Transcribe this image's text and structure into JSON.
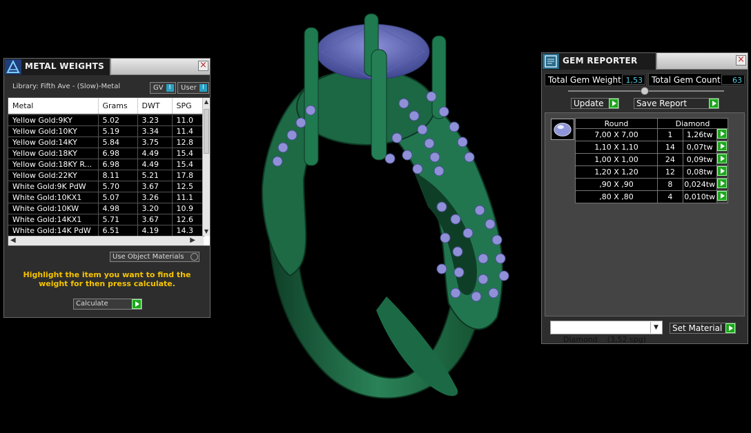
{
  "metal_weights": {
    "title": "METAL WEIGHTS",
    "library": "Library: Fifth Ave - (Slow)-Metal",
    "gv_label": "GV",
    "user_label": "User",
    "columns": [
      "Metal",
      "Grams",
      "DWT",
      "SPG"
    ],
    "rows": [
      [
        "Yellow Gold:9KY",
        "5.02",
        "3.23",
        "11.0"
      ],
      [
        "Yellow Gold:10KY",
        "5.19",
        "3.34",
        "11.4"
      ],
      [
        "Yellow Gold:14KY",
        "5.84",
        "3.75",
        "12.8"
      ],
      [
        "Yellow Gold:18KY",
        "6.98",
        "4.49",
        "15.4"
      ],
      [
        "Yellow Gold:18KY R...",
        "6.98",
        "4.49",
        "15.4"
      ],
      [
        "Yellow Gold:22KY",
        "8.11",
        "5.21",
        "17.8"
      ],
      [
        "White Gold:9K PdW",
        "5.70",
        "3.67",
        "12.5"
      ],
      [
        "White Gold:10KX1",
        "5.07",
        "3.26",
        "11.1"
      ],
      [
        "White Gold:10KW",
        "4.98",
        "3.20",
        "10.9"
      ],
      [
        "White Gold:14KX1",
        "5.71",
        "3.67",
        "12.6"
      ],
      [
        "White Gold:14K PdW",
        "6.51",
        "4.19",
        "14.3"
      ]
    ],
    "use_object_materials": "Use Object Materials",
    "hint": "Highlight the item you want to find the weight for then press calculate.",
    "calculate_label": "Calculate"
  },
  "gem_reporter": {
    "title": "GEM REPORTER",
    "total_weight_label": "Total Gem Weight",
    "total_weight": "1,53",
    "total_count_label": "Total Gem Count",
    "total_count": "63",
    "update_label": "Update",
    "save_report_label": "Save Report",
    "shape": "Round",
    "material": "Diamond",
    "gems": [
      [
        "7,00 X 7,00",
        "1",
        "1,26tw"
      ],
      [
        "1,10 X 1,10",
        "14",
        "0,07tw"
      ],
      [
        "1,00 X 1,00",
        "24",
        "0,09tw"
      ],
      [
        "1,20 X 1,20",
        "12",
        "0,08tw"
      ],
      [
        ",90 X ,90",
        "8",
        "0,024tw"
      ],
      [
        ",80 X ,80",
        "4",
        "0,010tw"
      ]
    ],
    "material_select": "Diamond    (3,52 spg)",
    "set_material_label": "Set Material"
  },
  "colors": {
    "ring": "#1f6b45",
    "gem": "#8f90d8",
    "hint": "#f6c400",
    "count": "#4fd0e0",
    "go": "#1fa51f"
  }
}
